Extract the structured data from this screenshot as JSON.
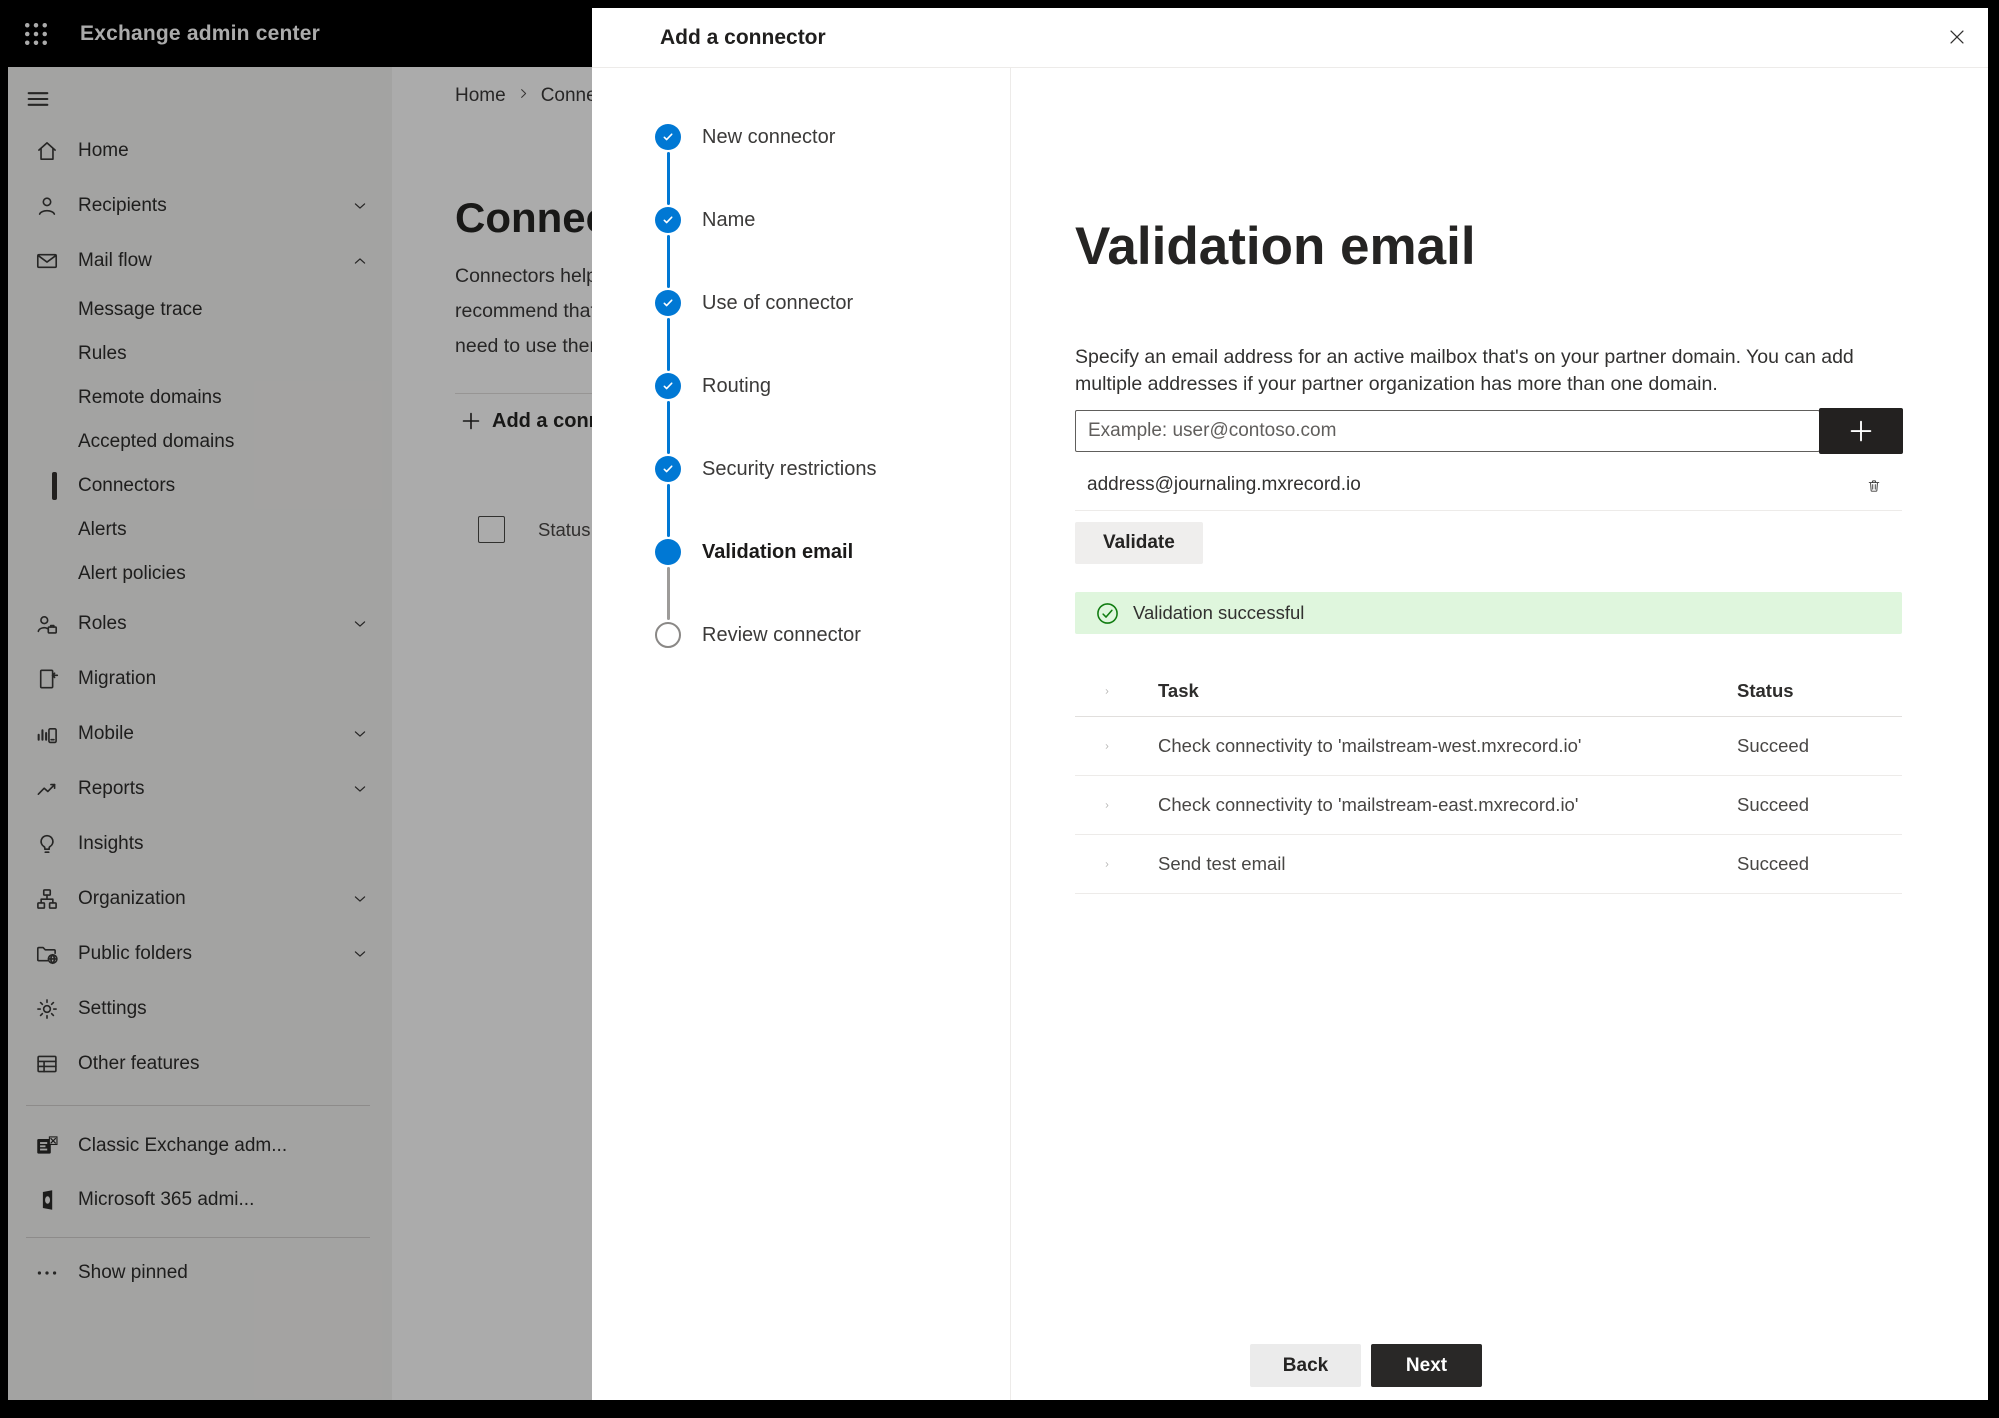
{
  "topbar": {
    "title": "Exchange admin center",
    "waffle_icon": "apps-grid-icon"
  },
  "sidebar": {
    "items": [
      {
        "label": "Home",
        "icon": "home-icon",
        "level": "top"
      },
      {
        "label": "Recipients",
        "icon": "person-icon",
        "level": "top",
        "chevron": "down"
      },
      {
        "label": "Mail flow",
        "icon": "mail-icon",
        "level": "top",
        "chevron": "up"
      },
      {
        "label": "Message trace",
        "level": "sub"
      },
      {
        "label": "Rules",
        "level": "sub"
      },
      {
        "label": "Remote domains",
        "level": "sub"
      },
      {
        "label": "Accepted domains",
        "level": "sub"
      },
      {
        "label": "Connectors",
        "level": "sub",
        "selected": true
      },
      {
        "label": "Alerts",
        "level": "sub"
      },
      {
        "label": "Alert policies",
        "level": "sub"
      },
      {
        "label": "Roles",
        "icon": "roles-icon",
        "level": "top",
        "chevron": "down"
      },
      {
        "label": "Migration",
        "icon": "migration-icon",
        "level": "top"
      },
      {
        "label": "Mobile",
        "icon": "mobile-icon",
        "level": "top",
        "chevron": "down"
      },
      {
        "label": "Reports",
        "icon": "reports-icon",
        "level": "top",
        "chevron": "down"
      },
      {
        "label": "Insights",
        "icon": "insights-icon",
        "level": "top"
      },
      {
        "label": "Organization",
        "icon": "organization-icon",
        "level": "top",
        "chevron": "down"
      },
      {
        "label": "Public folders",
        "icon": "public-folders-icon",
        "level": "top",
        "chevron": "down"
      },
      {
        "label": "Settings",
        "icon": "settings-icon",
        "level": "top"
      },
      {
        "label": "Other features",
        "icon": "other-features-icon",
        "level": "top"
      }
    ],
    "footer_items": [
      {
        "label": "Classic Exchange adm...",
        "icon": "classic-exchange-icon"
      },
      {
        "label": "Microsoft 365 admi...",
        "icon": "microsoft-365-icon"
      }
    ],
    "show_pinned": {
      "label": "Show pinned",
      "icon": "ellipsis-icon"
    }
  },
  "page": {
    "breadcrumb": [
      "Home",
      "Connectors"
    ],
    "title": "Connectors",
    "description_lines": [
      "Connectors help",
      "recommend that",
      "need to use them"
    ],
    "add_button_label": "Add a connector",
    "status_column_label": "Status"
  },
  "dialog": {
    "title": "Add a connector",
    "steps": [
      {
        "label": "New connector",
        "state": "done"
      },
      {
        "label": "Name",
        "state": "done"
      },
      {
        "label": "Use of connector",
        "state": "done"
      },
      {
        "label": "Routing",
        "state": "done"
      },
      {
        "label": "Security restrictions",
        "state": "done"
      },
      {
        "label": "Validation email",
        "state": "current"
      },
      {
        "label": "Review connector",
        "state": "upcoming"
      }
    ],
    "content": {
      "heading": "Validation email",
      "description_lines": [
        "Specify an email address for an active mailbox that's on your partner domain. You can add",
        "multiple addresses if your partner organization has more than one domain."
      ],
      "input_placeholder": "Example: user@contoso.com",
      "address_value": "address@journaling.mxrecord.io",
      "validate_label": "Validate",
      "banner_text": "Validation successful",
      "table": {
        "task_header": "Task",
        "status_header": "Status",
        "rows": [
          {
            "task": "Check connectivity to 'mailstream-west.mxrecord.io'",
            "status": "Succeed"
          },
          {
            "task": "Check connectivity to 'mailstream-east.mxrecord.io'",
            "status": "Succeed"
          },
          {
            "task": "Send test email",
            "status": "Succeed"
          }
        ]
      }
    },
    "footer": {
      "back_label": "Back",
      "next_label": "Next"
    }
  },
  "colors": {
    "accent_blue": "#0078d4",
    "success_green": "#107c10",
    "banner_green_bg": "#dff6dd",
    "topbar_bg": "#000000",
    "dark_button_bg": "#292827",
    "overlay": "rgba(0,0,0,0.33)"
  }
}
